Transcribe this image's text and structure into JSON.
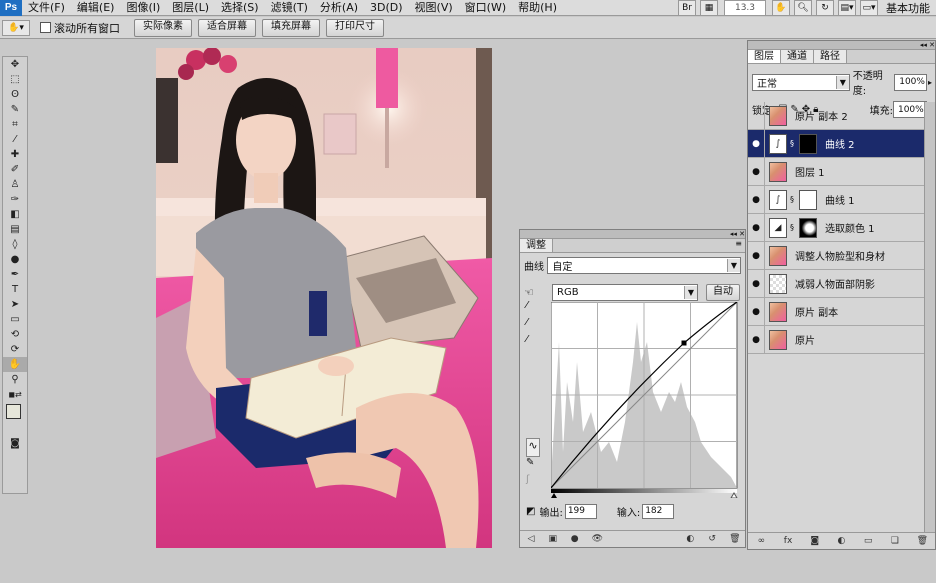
{
  "menubar": {
    "logo": "Ps",
    "items": [
      "文件(F)",
      "编辑(E)",
      "图像(I)",
      "图层(L)",
      "选择(S)",
      "滤镜(T)",
      "分析(A)",
      "3D(D)",
      "视图(V)",
      "窗口(W)",
      "帮助(H)"
    ],
    "zoom": "13.3",
    "workspace": "基本功能"
  },
  "options_bar": {
    "scroll_all_label": "滚动所有窗口",
    "buttons": [
      "实际像素",
      "适合屏幕",
      "填充屏幕",
      "打印尺寸"
    ]
  },
  "curves_panel": {
    "tabs": [
      "调整"
    ],
    "preset_label": "曲线",
    "preset_value": "自定",
    "channel": "RGB",
    "auto_label": "自动",
    "output_label": "输出:",
    "output_value": "199",
    "input_label": "输入:",
    "input_value": "182"
  },
  "layers_panel": {
    "tabs": [
      "图层",
      "通道",
      "路径"
    ],
    "blend_mode": "正常",
    "opacity_label": "不透明度:",
    "opacity_value": "100%",
    "lock_label": "锁定:",
    "fill_label": "填充:",
    "fill_value": "100%",
    "layers": [
      {
        "name": "原片 副本 2",
        "type": "photo",
        "visible": false,
        "selected": false
      },
      {
        "name": "曲线 2",
        "type": "curves",
        "visible": true,
        "selected": true
      },
      {
        "name": "图层 1",
        "type": "photo",
        "visible": true,
        "selected": false
      },
      {
        "name": "曲线 1",
        "type": "curves",
        "visible": true,
        "selected": false
      },
      {
        "name": "选取颜色 1",
        "type": "selective",
        "visible": true,
        "selected": false
      },
      {
        "name": "调整人物脸型和身材",
        "type": "photo",
        "visible": true,
        "selected": false
      },
      {
        "name": "减弱人物面部阴影",
        "type": "blank",
        "visible": true,
        "selected": false
      },
      {
        "name": "原片 副本",
        "type": "photo",
        "visible": true,
        "selected": false
      },
      {
        "name": "原片",
        "type": "photo",
        "visible": true,
        "selected": false
      }
    ]
  }
}
